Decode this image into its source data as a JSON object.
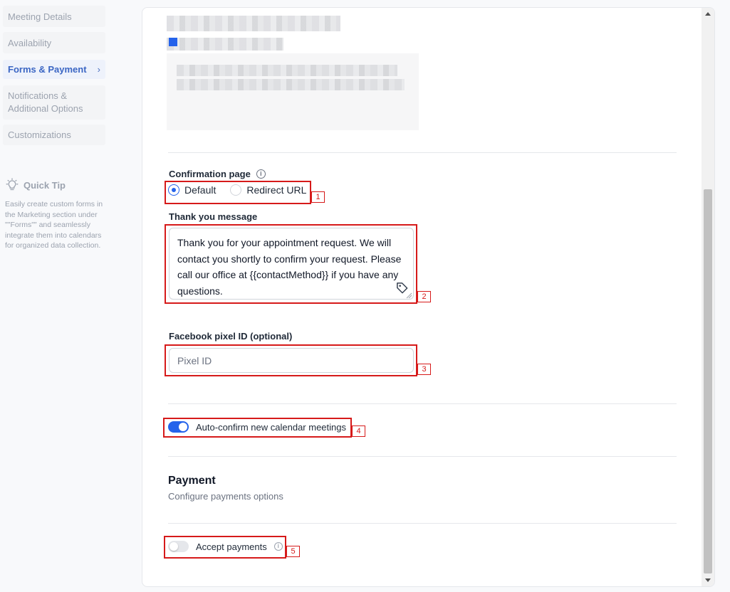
{
  "sidebar": {
    "items": [
      {
        "label": "Meeting Details"
      },
      {
        "label": "Availability"
      },
      {
        "label": "Forms & Payment",
        "chevron": "›"
      },
      {
        "label": "Notifications & Additional Options"
      },
      {
        "label": "Customizations"
      }
    ],
    "tip": {
      "icon": "lightbulb-icon",
      "title": "Quick Tip",
      "body": "Easily create custom forms in the Marketing section under \"\"Forms\"\" and seamlessly integrate them into calendars for organized data collection."
    }
  },
  "confirmation": {
    "label": "Confirmation page",
    "info": "i",
    "options": [
      {
        "label": "Default",
        "selected": true
      },
      {
        "label": "Redirect URL",
        "selected": false
      }
    ]
  },
  "thank_you": {
    "label": "Thank you message",
    "value": "Thank you for your appointment request. We will contact you shortly to confirm your request. Please call our office at {{contactMethod}} if you have any questions.",
    "icon": "tag-icon"
  },
  "pixel": {
    "label": "Facebook pixel ID (optional)",
    "placeholder": "Pixel ID",
    "value": ""
  },
  "auto_confirm": {
    "label": "Auto-confirm new calendar meetings",
    "enabled": true
  },
  "payment": {
    "title": "Payment",
    "subtitle": "Configure payments options",
    "accept_label": "Accept payments",
    "accept_enabled": false,
    "info": "i"
  },
  "annotations": [
    "1",
    "2",
    "3",
    "4",
    "5"
  ],
  "colors": {
    "accent": "#2563eb",
    "annotation": "#d61a1a",
    "active_nav": "#3b66c4"
  }
}
